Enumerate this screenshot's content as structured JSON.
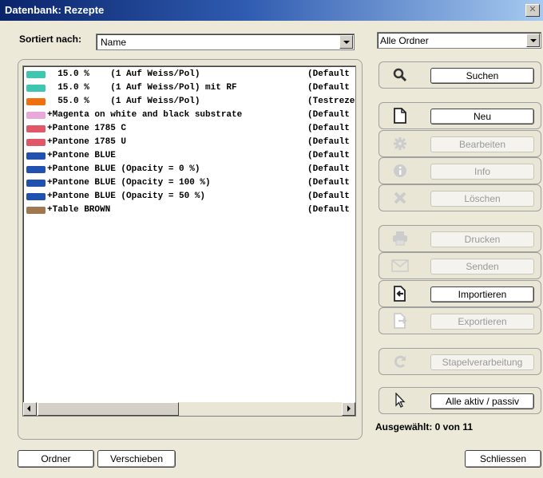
{
  "window": {
    "title": "Datenbank: Rezepte",
    "close_label": "✕"
  },
  "sort": {
    "label": "Sortiert nach:",
    "value": "Name"
  },
  "folder": {
    "value": "Alle Ordner"
  },
  "list": {
    "rows": [
      {
        "color": "#3ec6b0",
        "name": "  15.0 %    (1 Auf Weiss/Pol)",
        "source": "(Default"
      },
      {
        "color": "#3ec6b0",
        "name": "  15.0 %    (1 Auf Weiss/Pol) mit RF",
        "source": "(Default"
      },
      {
        "color": "#f07010",
        "name": "  55.0 %    (1 Auf Weiss/Pol)",
        "source": "(Testreze"
      },
      {
        "color": "#e8a8d8",
        "name": "+Magenta on white and black substrate",
        "source": "(Default"
      },
      {
        "color": "#e05868",
        "name": "+Pantone 1785 C",
        "source": "(Default"
      },
      {
        "color": "#e05868",
        "name": "+Pantone 1785 U",
        "source": "(Default"
      },
      {
        "color": "#2050b0",
        "name": "+Pantone BLUE",
        "source": "(Default"
      },
      {
        "color": "#2050b0",
        "name": "+Pantone BLUE (Opacity = 0 %)",
        "source": "(Default"
      },
      {
        "color": "#2050b0",
        "name": "+Pantone BLUE (Opacity = 100 %)",
        "source": "(Default"
      },
      {
        "color": "#2050b0",
        "name": "+Pantone BLUE (Opacity = 50 %)",
        "source": "(Default"
      },
      {
        "color": "#a07850",
        "name": "+Table BROWN",
        "source": "(Default"
      }
    ]
  },
  "actions": {
    "search": "Suchen",
    "new": "Neu",
    "edit": "Bearbeiten",
    "info": "Info",
    "delete": "Löschen",
    "print": "Drucken",
    "send": "Senden",
    "import": "Importieren",
    "export": "Exportieren",
    "batch": "Stapelverarbeitung",
    "toggle_all": "Alle aktiv / passiv"
  },
  "status": {
    "selected": "Ausgewählt: 0 von 11"
  },
  "footer": {
    "folder": "Ordner",
    "move": "Verschieben",
    "close": "Schliessen"
  }
}
